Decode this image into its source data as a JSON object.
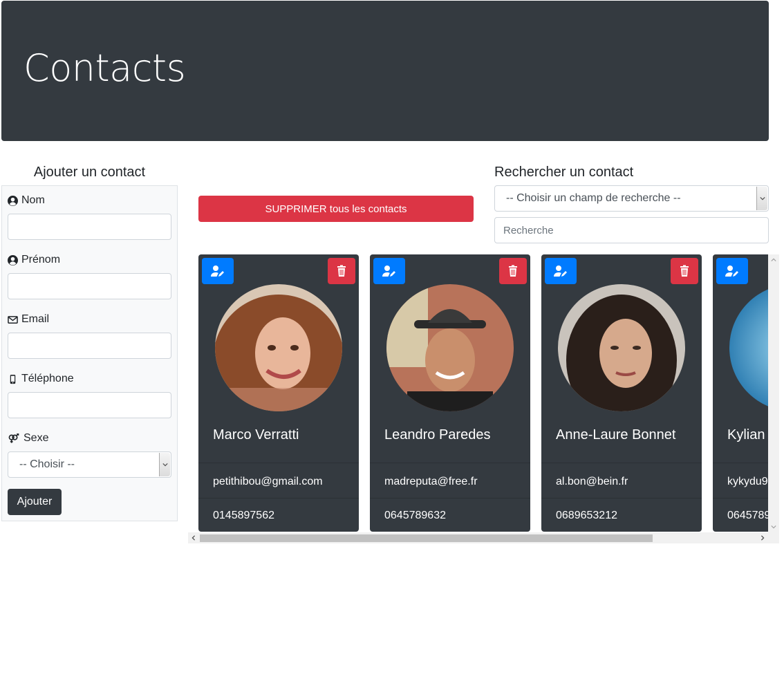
{
  "header": {
    "title": "Contacts"
  },
  "add_form": {
    "title": "Ajouter un contact",
    "fields": {
      "nom": "Nom",
      "prenom": "Prénom",
      "email": "Email",
      "telephone": "Téléphone",
      "sexe": "Sexe"
    },
    "sexe_select": "-- Choisir --",
    "submit_label": "Ajouter"
  },
  "actions": {
    "delete_all_label": "SUPPRIMER tous les contacts"
  },
  "search": {
    "title": "Rechercher un contact",
    "field_select": "-- Choisir un champ de recherche --",
    "placeholder": "Recherche"
  },
  "contacts": [
    {
      "name": "Marco Verratti",
      "email": "petithibou@gmail.com",
      "phone": "0145897562"
    },
    {
      "name": "Leandro Paredes",
      "email": "madreputa@free.fr",
      "phone": "0645789632"
    },
    {
      "name": "Anne-Laure Bonnet",
      "email": "al.bon@bein.fr",
      "phone": "0689653212"
    },
    {
      "name": "Kylian",
      "email": "kykydu9",
      "phone": "0645789"
    }
  ],
  "colors": {
    "dark": "#343a40",
    "primary": "#007bff",
    "danger": "#dc3545",
    "light": "#f8f9fa"
  }
}
